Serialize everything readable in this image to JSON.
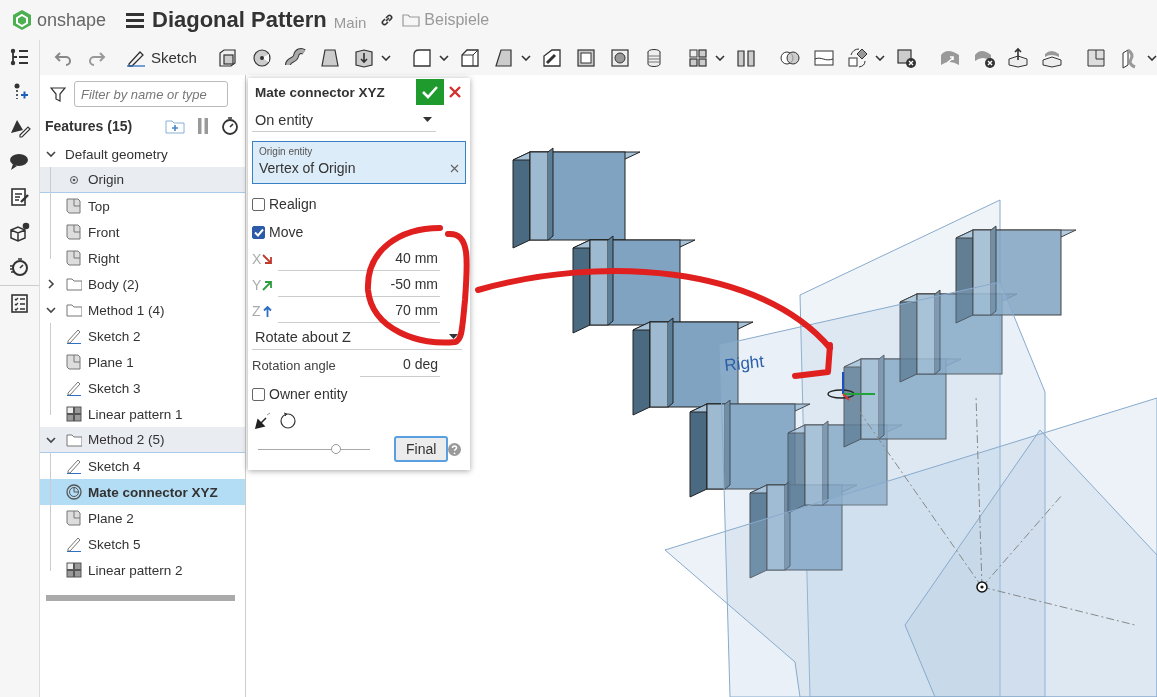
{
  "app": {
    "logo_text": "onshape",
    "document_title": "Diagonal Pattern",
    "branch": "Main",
    "folder": "Beispiele"
  },
  "toolbar": {
    "sketch_label": "Sketch"
  },
  "feature_panel": {
    "filter_placeholder": "Filter by name or type",
    "heading": "Features (15)",
    "items": [
      {
        "label": "Default geometry",
        "kind": "group",
        "expanded": true,
        "selected": false,
        "highlighted": false,
        "children": [
          {
            "label": "Origin",
            "kind": "origin",
            "selected": false,
            "highlighted": true
          },
          {
            "label": "Top",
            "kind": "plane",
            "selected": false,
            "highlighted": false
          },
          {
            "label": "Front",
            "kind": "plane",
            "selected": false,
            "highlighted": false
          },
          {
            "label": "Right",
            "kind": "plane",
            "selected": false,
            "highlighted": false
          }
        ]
      },
      {
        "label": "Body (2)",
        "kind": "folder",
        "expanded": false,
        "selected": false,
        "highlighted": false
      },
      {
        "label": "Method 1 (4)",
        "kind": "folder",
        "expanded": true,
        "selected": false,
        "highlighted": false,
        "children": [
          {
            "label": "Sketch 2",
            "kind": "sketch",
            "selected": false,
            "highlighted": false
          },
          {
            "label": "Plane 1",
            "kind": "plane",
            "selected": false,
            "highlighted": false
          },
          {
            "label": "Sketch 3",
            "kind": "sketch",
            "selected": false,
            "highlighted": false
          },
          {
            "label": "Linear pattern 1",
            "kind": "pattern",
            "selected": false,
            "highlighted": false
          }
        ]
      },
      {
        "label": "Method 2 (5)",
        "kind": "folder",
        "expanded": true,
        "selected": false,
        "highlighted": true,
        "children": [
          {
            "label": "Sketch 4",
            "kind": "sketch",
            "selected": false,
            "highlighted": false
          },
          {
            "label": "Mate connector XYZ",
            "kind": "mate",
            "selected": true,
            "highlighted": false
          },
          {
            "label": "Plane 2",
            "kind": "plane",
            "selected": false,
            "highlighted": false
          },
          {
            "label": "Sketch 5",
            "kind": "sketch",
            "selected": false,
            "highlighted": false
          },
          {
            "label": "Linear pattern 2",
            "kind": "pattern",
            "selected": false,
            "highlighted": false
          }
        ]
      }
    ]
  },
  "dialog": {
    "title": "Mate connector XYZ",
    "placement": "On entity",
    "origin_entity": {
      "label": "Origin entity",
      "value": "Vertex of Origin"
    },
    "realign": {
      "label": "Realign",
      "checked": false
    },
    "move": {
      "label": "Move",
      "checked": true
    },
    "offsets": [
      {
        "axis": "X",
        "value": "40 mm",
        "color": "#c0392b"
      },
      {
        "axis": "Y",
        "value": "-50 mm",
        "color": "#2e9e3e"
      },
      {
        "axis": "Z",
        "value": "70 mm",
        "color": "#2f6fc0"
      }
    ],
    "rotation": "Rotate about Z",
    "rotation_angle": {
      "label": "Rotation angle",
      "value": "0 deg"
    },
    "owner_entity": {
      "label": "Owner entity",
      "checked": false
    },
    "slider": {
      "level": 0.7
    },
    "final_button": "Final"
  },
  "viewport": {
    "plane_label": "Right"
  }
}
